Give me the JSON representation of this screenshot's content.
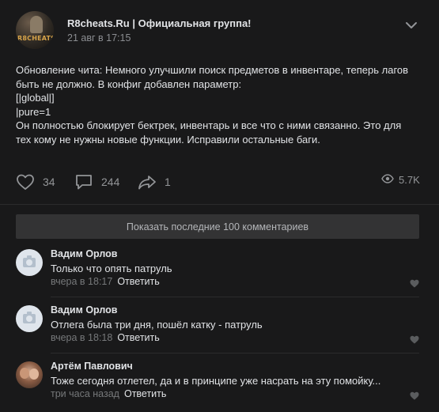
{
  "post": {
    "group_name": "R8cheats.Ru | Официальная группа!",
    "date": "21 авг в 17:15",
    "avatar_text": "R8CHEATS",
    "text_lines": [
      "Обновление чита: Немного улучшили поиск предметов в инвентаре, теперь лагов",
      "быть не должно. В конфиг добавлен параметр:",
      "[|global|]",
      "|pure=1",
      "Он полностью блокирует бектрек, инвентарь и все что с ними связанно. Это для",
      "тех кому не нужны новые функции. Исправили остальные баги."
    ],
    "likes": "34",
    "comments": "244",
    "shares": "1",
    "views": "5.7K"
  },
  "show_more_label": "Показать последние 100 комментариев",
  "comments": [
    {
      "author": "Вадим Орлов",
      "text": "Только что опять патруль",
      "time": "вчера в 18:17",
      "reply": "Ответить"
    },
    {
      "author": "Вадим Орлов",
      "text": "Отлега была три дня, пошёл катку - патруль",
      "time": "вчера в 18:18",
      "reply": "Ответить"
    },
    {
      "author": "Артём Павлович",
      "text": "Тоже сегодня отлетел, да и в принципе уже насрать на эту помойку...",
      "time": "три часа назад",
      "reply": "Ответить"
    }
  ],
  "icons": {
    "like": "heart-icon",
    "comment": "comment-icon",
    "share": "share-icon",
    "views": "eye-icon",
    "menu": "chevron-down-icon",
    "default_avatar": "camera-icon",
    "comment_like": "heart-icon"
  },
  "colors": {
    "background": "#19191a",
    "text": "#e1e3e6",
    "secondary": "#939598",
    "button_bg": "#333334"
  }
}
